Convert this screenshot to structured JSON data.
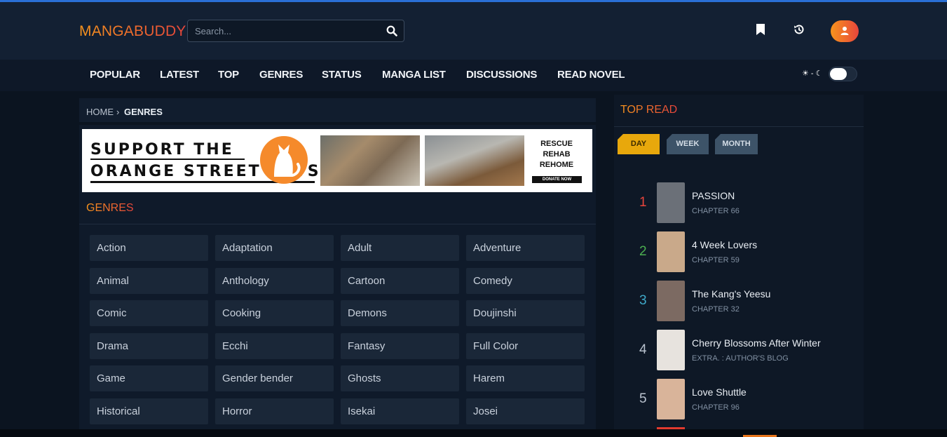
{
  "header": {
    "logo": "MANGABUDDY",
    "search_placeholder": "Search..."
  },
  "nav": {
    "items": [
      "POPULAR",
      "LATEST",
      "TOP",
      "GENRES",
      "STATUS",
      "MANGA LIST",
      "DISCUSSIONS",
      "READ NOVEL"
    ],
    "theme_symbols": "☀ - ☾"
  },
  "breadcrumb": {
    "home": "HOME",
    "sep": "›",
    "current": "GENRES"
  },
  "banner": {
    "line1": "SUPPORT THE",
    "line2": "ORANGE STREET CATS",
    "rescue": [
      "RESCUE",
      "REHAB",
      "REHOME"
    ],
    "donate": "DONATE NOW"
  },
  "genres": {
    "title": "GENRES",
    "items": [
      "Action",
      "Adaptation",
      "Adult",
      "Adventure",
      "Animal",
      "Anthology",
      "Cartoon",
      "Comedy",
      "Comic",
      "Cooking",
      "Demons",
      "Doujinshi",
      "Drama",
      "Ecchi",
      "Fantasy",
      "Full Color",
      "Game",
      "Gender bender",
      "Ghosts",
      "Harem",
      "Historical",
      "Horror",
      "Isekai",
      "Josei"
    ]
  },
  "sidebar": {
    "title": "TOP READ",
    "tabs": [
      "DAY",
      "WEEK",
      "MONTH"
    ],
    "items": [
      {
        "rank": "1",
        "title": "PASSION",
        "sub": "CHAPTER 66",
        "rank_color": "#e8453c",
        "cover": "#6b7078"
      },
      {
        "rank": "2",
        "title": "4 Week Lovers",
        "sub": "CHAPTER 59",
        "rank_color": "#4caf50",
        "cover": "#c9a98a"
      },
      {
        "rank": "3",
        "title": "The Kang's Yeesu",
        "sub": "CHAPTER 32",
        "rank_color": "#3fa9c9",
        "cover": "#7c6a62"
      },
      {
        "rank": "4",
        "title": "Cherry Blossoms After Winter",
        "sub": "EXTRA. : AUTHOR'S BLOG",
        "rank_color": "#b9c2ce",
        "cover": "#e7e3de"
      },
      {
        "rank": "5",
        "title": "Love Shuttle",
        "sub": "CHAPTER 96",
        "rank_color": "#b9c2ce",
        "cover": "#d9b49a"
      }
    ]
  }
}
